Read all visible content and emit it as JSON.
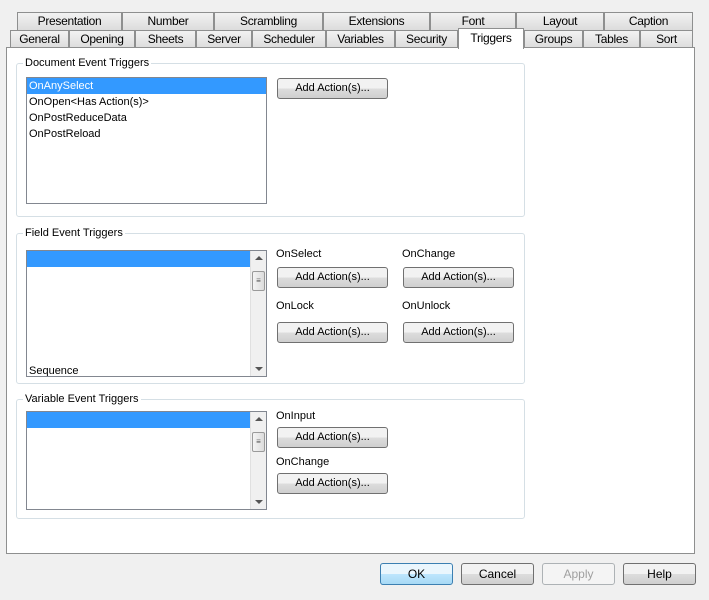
{
  "tabs_row1": [
    "Presentation",
    "Number",
    "Scrambling",
    "Extensions",
    "Font",
    "Layout",
    "Caption"
  ],
  "tabs_row2": [
    "General",
    "Opening",
    "Sheets",
    "Server",
    "Scheduler",
    "Variables",
    "Security",
    "Triggers",
    "Groups",
    "Tables",
    "Sort"
  ],
  "active_tab": "Triggers",
  "document": {
    "title": "Document Event Triggers",
    "items": [
      "OnAnySelect",
      "OnOpen<Has Action(s)>",
      "OnPostReduceData",
      "OnPostReload"
    ],
    "selected": 0,
    "add_label": "Add Action(s)..."
  },
  "field": {
    "title": "Field Event Triggers",
    "items": [
      "",
      "",
      "",
      "",
      "",
      "",
      "",
      "Sequence"
    ],
    "on_select": "OnSelect",
    "on_change": "OnChange",
    "on_lock": "OnLock",
    "on_unlock": "OnUnlock",
    "add_label": "Add Action(s)..."
  },
  "variable": {
    "title": "Variable Event Triggers",
    "items": [
      "",
      "",
      "",
      "",
      "",
      ""
    ],
    "on_input": "OnInput",
    "on_change": "OnChange",
    "add_label": "Add Action(s)..."
  },
  "footer": {
    "ok": "OK",
    "cancel": "Cancel",
    "apply": "Apply",
    "help": "Help",
    "apply_enabled": false
  },
  "colors": {
    "selection": "#3399ff",
    "ok_border": "#3c7fb1"
  }
}
